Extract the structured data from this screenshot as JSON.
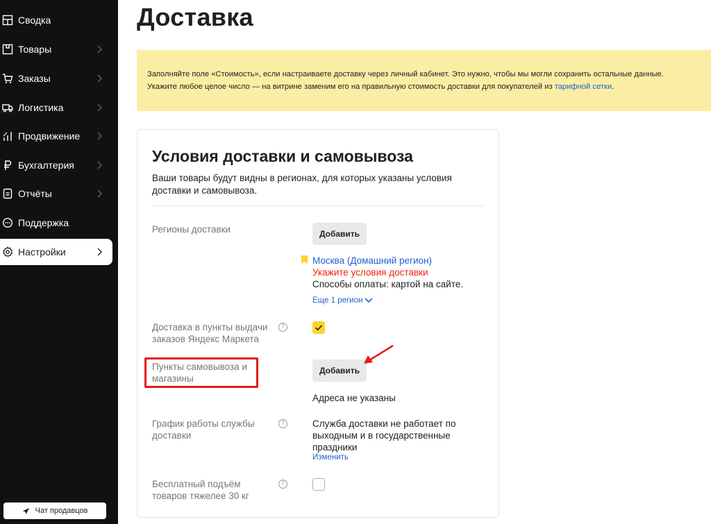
{
  "sidebar": {
    "items": [
      {
        "label": "Сводка",
        "icon": "dashboard-icon",
        "has_chevron": false
      },
      {
        "label": "Товары",
        "icon": "products-icon",
        "has_chevron": true
      },
      {
        "label": "Заказы",
        "icon": "cart-icon",
        "has_chevron": true
      },
      {
        "label": "Логистика",
        "icon": "truck-icon",
        "has_chevron": true
      },
      {
        "label": "Продвижение",
        "icon": "chart-icon",
        "has_chevron": true
      },
      {
        "label": "Бухгалтерия",
        "icon": "ruble-icon",
        "has_chevron": true
      },
      {
        "label": "Отчёты",
        "icon": "report-icon",
        "has_chevron": true
      },
      {
        "label": "Поддержка",
        "icon": "support-icon",
        "has_chevron": false
      },
      {
        "label": "Настройки",
        "icon": "gear-icon",
        "has_chevron": true,
        "active": true
      }
    ],
    "chat_button": "Чат продавцов"
  },
  "page": {
    "title": "Доставка"
  },
  "notice": {
    "line1": "Заполняйте поле «Стоимость», если настраиваете доставку через личный кабинет. Это нужно, чтобы мы могли сохранить остальные данные.",
    "line2_prefix": "Укажите любое целое число — на витрине заменим его на правильную стоимость доставки для покупателей из ",
    "line2_link": "тарифной сетки",
    "line2_suffix": "."
  },
  "card": {
    "title": "Условия доставки и самовывоза",
    "description": "Ваши товары будут видны в регионах, для которых указаны условия доставки и самовывоза.",
    "regions": {
      "label": "Регионы доставки",
      "add_button": "Добавить",
      "region_name": "Москва (Домашний регион)",
      "region_warning": "Укажите условия доставки",
      "payment": "Способы оплаты: картой на сайте.",
      "more_link": "Еще 1 регион"
    },
    "pickup_points_market": {
      "label": "Доставка в пункты выдачи заказов Яндекс Маркета",
      "checked": true
    },
    "pickup_stores": {
      "label": "Пункты самовывоза и магазины",
      "add_button": "Добавить",
      "status": "Адреса не указаны"
    },
    "schedule": {
      "label": "График работы службы доставки",
      "text": "Служба доставки не работает по выходным и в государственные праздники",
      "change_link": "Изменить"
    },
    "free_lift": {
      "label": "Бесплатный подъём товаров тяжелее 30 кг",
      "checked": false
    }
  },
  "colors": {
    "sidebar_bg": "#111111",
    "notice_bg": "#fbeea4",
    "link": "#1f5fcf",
    "warning": "#f0200d",
    "checkbox_checked": "#fed42b",
    "annotation_red": "#e21a1a"
  }
}
